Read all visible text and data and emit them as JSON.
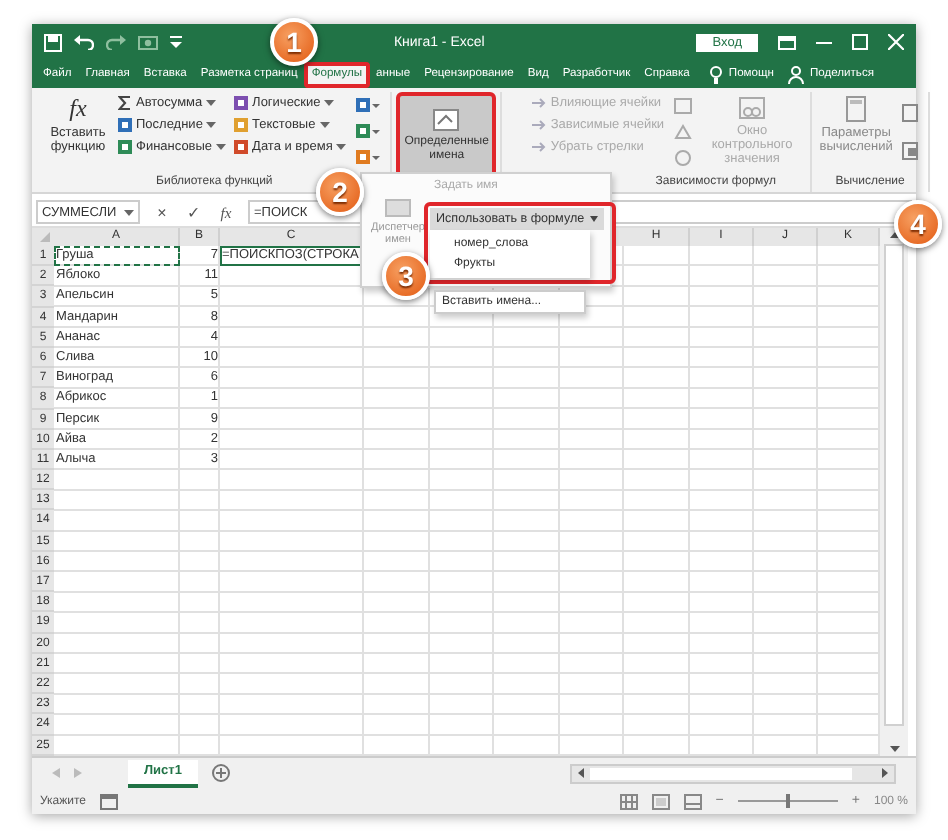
{
  "window": {
    "title": "Книга1 - Excel",
    "sign_in": "Вход"
  },
  "tabs": [
    {
      "label": "Файл",
      "selected": false,
      "framed": false
    },
    {
      "label": "Главная",
      "selected": false,
      "framed": false
    },
    {
      "label": "Вставка",
      "selected": false,
      "framed": false
    },
    {
      "label": "Разметка страниц",
      "selected": false,
      "framed": false
    },
    {
      "label": "Формулы",
      "selected": true,
      "framed": true
    },
    {
      "label": "анные",
      "selected": false,
      "framed": false
    },
    {
      "label": "Рецензирование",
      "selected": false,
      "framed": false
    },
    {
      "label": "Вид",
      "selected": false,
      "framed": false
    },
    {
      "label": "Разработчик",
      "selected": false,
      "framed": false
    },
    {
      "label": "Справка",
      "selected": false,
      "framed": false
    }
  ],
  "tell_me": "Помощн",
  "share": "Поделиться",
  "ribbon": {
    "insert_function": {
      "glyph": "fx",
      "label": "Вставить функцию"
    },
    "library": [
      {
        "label": "Автосумма",
        "kind": "sum"
      },
      {
        "label": "Последние",
        "kind": "recent"
      },
      {
        "label": "Финансовые",
        "kind": "finance"
      },
      {
        "label": "Логические",
        "kind": "logic"
      },
      {
        "label": "Текстовые",
        "kind": "text"
      },
      {
        "label": "Дата и время",
        "kind": "date"
      }
    ],
    "library_label": "Библиотека функций",
    "defined_names": {
      "label": "Определенные имена",
      "selected": true,
      "framed": true
    },
    "auditing": [
      {
        "label": "Влияющие ячейки",
        "disabled": true
      },
      {
        "label": "Зависимые ячейки",
        "disabled": true
      },
      {
        "label": "Убрать стрелки",
        "disabled": true
      }
    ],
    "watch_window": {
      "label": "Окно контрольного значения",
      "disabled": true
    },
    "auditing_label": "Зависимости формул",
    "calc_options": {
      "label": "Параметры вычислений"
    },
    "calc_label": "Вычисление"
  },
  "formula_bar": {
    "name_box": "СУММЕСЛИ",
    "cancel": "×",
    "enter": "✓",
    "fx": "fx",
    "formula": "=ПОИСК"
  },
  "columns_left": [
    "A",
    "B",
    "C"
  ],
  "columns_right": [
    "H",
    "I",
    "J",
    "K"
  ],
  "rows": [
    {
      "n": "1",
      "a": "Груша",
      "b": "7",
      "c": "=ПОИСКПОЗ(СТРОКА",
      "copied": true,
      "active": true
    },
    {
      "n": "2",
      "a": "Яблоко",
      "b": "11"
    },
    {
      "n": "3",
      "a": "Апельсин",
      "b": "5"
    },
    {
      "n": "4",
      "a": "Мандарин",
      "b": "8"
    },
    {
      "n": "5",
      "a": "Ананас",
      "b": "4"
    },
    {
      "n": "6",
      "a": "Слива",
      "b": "10"
    },
    {
      "n": "7",
      "a": "Виноград",
      "b": "6"
    },
    {
      "n": "8",
      "a": "Абрикос",
      "b": "1"
    },
    {
      "n": "9",
      "a": "Персик",
      "b": "9"
    },
    {
      "n": "10",
      "a": "Айва",
      "b": "2"
    },
    {
      "n": "11",
      "a": "Алыча",
      "b": "3"
    },
    {
      "n": "12"
    },
    {
      "n": "13"
    },
    {
      "n": "14"
    },
    {
      "n": "15"
    },
    {
      "n": "16"
    },
    {
      "n": "17"
    },
    {
      "n": "18"
    },
    {
      "n": "19"
    },
    {
      "n": "20"
    },
    {
      "n": "21"
    },
    {
      "n": "22"
    },
    {
      "n": "23"
    },
    {
      "n": "24"
    },
    {
      "n": "25"
    }
  ],
  "names_menu": {
    "define": "Задать имя",
    "manager": "Диспетчер имен",
    "use_in_formula": "Использовать в формуле",
    "framed": true,
    "items": [
      {
        "label": "номер_слова"
      },
      {
        "label": "Фрукты"
      }
    ],
    "paste": "Вставить имена..."
  },
  "sheets": [
    {
      "label": "Лист1",
      "selected": true
    }
  ],
  "status": {
    "mode": "Укажите",
    "zoom_out": "−",
    "zoom_in": "+",
    "zoom": "100 %"
  },
  "zoom_slider": {
    "level": 0.5
  },
  "callouts": [
    {
      "number": "1"
    },
    {
      "number": "2"
    },
    {
      "number": "3"
    },
    {
      "number": "4"
    }
  ]
}
